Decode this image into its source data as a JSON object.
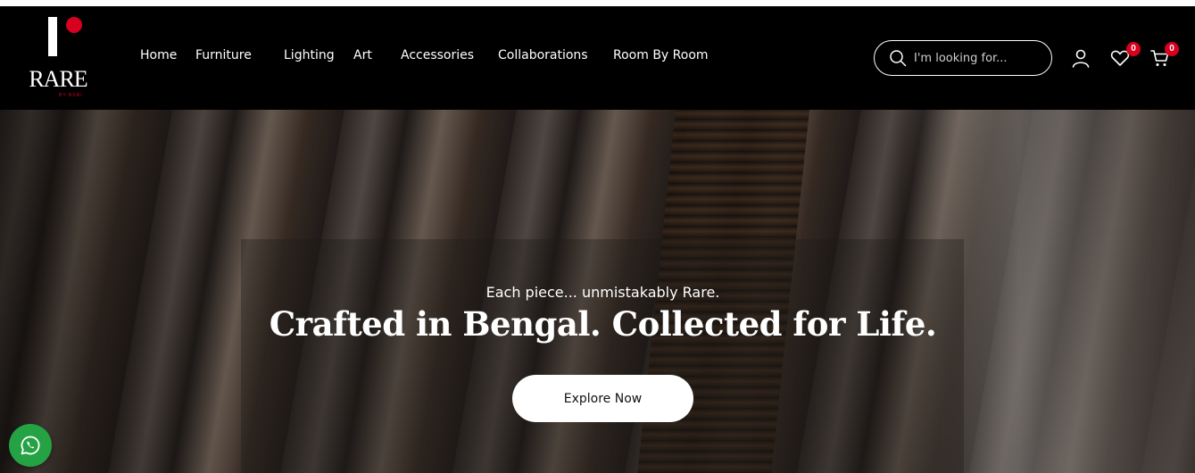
{
  "brand": {
    "logo_text": "RARE",
    "logo_sub": "BY BSRI",
    "accent_color": "#d7001f"
  },
  "nav": {
    "items": [
      {
        "label": "Home"
      },
      {
        "label": "Furniture"
      },
      {
        "label": "Lighting"
      },
      {
        "label": "Art"
      },
      {
        "label": "Accessories"
      },
      {
        "label": "Collaborations"
      },
      {
        "label": "Room By Room"
      }
    ]
  },
  "search": {
    "placeholder": "I'm looking for...",
    "icon": "search-icon"
  },
  "header_icons": {
    "account_icon": "user-icon",
    "wishlist_icon": "heart-icon",
    "wishlist_count": "0",
    "cart_icon": "cart-icon",
    "cart_count": "0"
  },
  "hero": {
    "tagline": "Each piece... unmistakably Rare.",
    "headline": "Crafted in Bengal. Collected for Life.",
    "cta_label": "Explore Now"
  },
  "floating": {
    "whatsapp_icon": "whatsapp-icon",
    "whatsapp_color": "#25a244"
  }
}
